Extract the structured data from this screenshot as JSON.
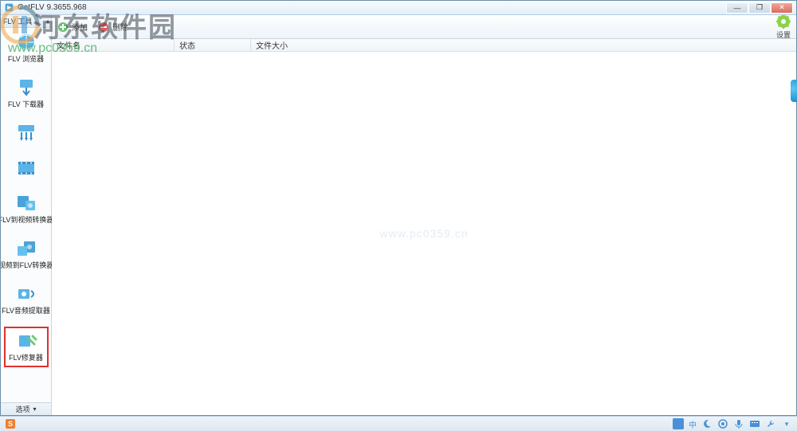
{
  "window": {
    "title": "GetFLV 9.3655.968"
  },
  "sidebar": {
    "header": "FLV 工具",
    "items": [
      {
        "label": "FLV 浏览器",
        "icon": "browser-icon"
      },
      {
        "label": "FLV 下载器",
        "icon": "downloader-icon"
      },
      {
        "label": "",
        "icon": "arrows-icon"
      },
      {
        "label": "",
        "icon": "film-icon"
      },
      {
        "label": "FLV到视频转换器",
        "icon": "flv-to-video-icon"
      },
      {
        "label": "视频到FLV转换器",
        "icon": "video-to-flv-icon"
      },
      {
        "label": "FLV音频提取器",
        "icon": "audio-extract-icon"
      },
      {
        "label": "FLV修复器",
        "icon": "repair-icon"
      }
    ],
    "footer": "选项"
  },
  "toolbar": {
    "add": "添加",
    "remove": "删除",
    "settings": "设置"
  },
  "columns": {
    "name": "文件名",
    "status": "状态",
    "size": "文件大小"
  },
  "watermark": {
    "center": "www.pc0359.cn",
    "logo_text": "河东软件园",
    "url": "www.pc0359.cn"
  },
  "tray": {
    "ime": "中"
  }
}
